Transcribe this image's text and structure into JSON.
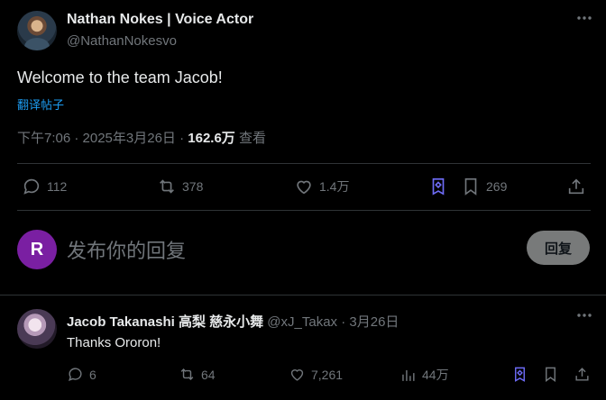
{
  "tweet": {
    "author_name": "Nathan Nokes | Voice Actor",
    "author_handle": "@NathanNokesvo",
    "text": "Welcome to the team Jacob!",
    "translate_label": "翻译帖子",
    "timestamp": "下午7:06 · 2025年3月26日 · ",
    "views_count": "162.6万",
    "views_label": " 查看",
    "actions": {
      "replies": "112",
      "reposts": "378",
      "likes": "1.4万",
      "bookmarks": "269"
    }
  },
  "composer": {
    "avatar_letter": "R",
    "placeholder": "发布你的回复",
    "reply_button": "回复"
  },
  "reply": {
    "author_name": "Jacob Takanashi 高梨 慈永小舞",
    "author_handle": "@xJ_Takax",
    "separator": " · ",
    "date": "3月26日",
    "text": "Thanks Ororon!",
    "actions": {
      "replies": "6",
      "reposts": "64",
      "likes": "7,261",
      "views": "44万"
    }
  },
  "icons": {
    "more": "more-horizontal-icon",
    "reply": "reply-bubble-icon",
    "repost": "repost-icon",
    "like": "heart-icon",
    "grok": "grok-icon",
    "bookmark": "bookmark-icon",
    "share": "share-icon",
    "views": "bar-chart-icon"
  },
  "colors": {
    "background": "#000000",
    "text_primary": "#e7e9ea",
    "text_secondary": "#71767b",
    "link": "#1d9bf0",
    "divider": "#2f3336",
    "avatar_me": "#7a1fa2",
    "grok_accent": "#6e6cf7",
    "reply_button_bg": "#787a7a"
  }
}
